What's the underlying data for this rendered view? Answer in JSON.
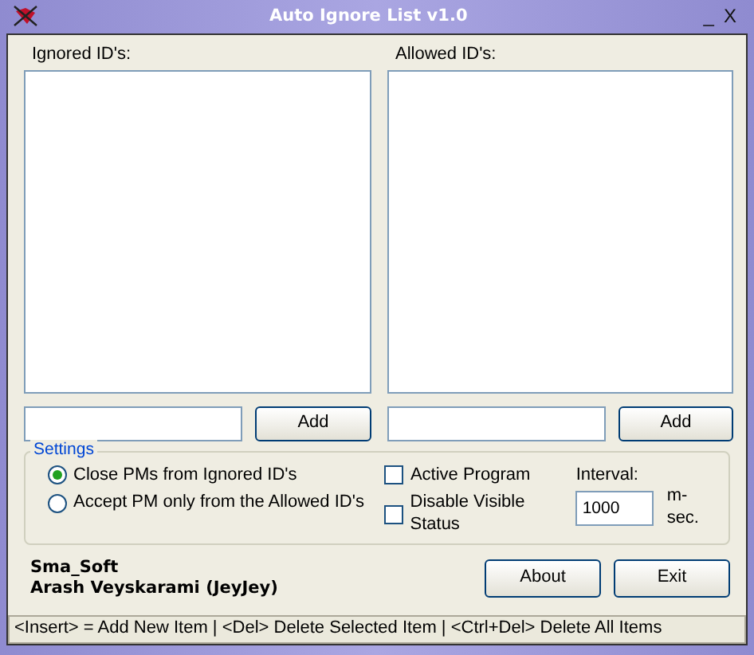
{
  "window": {
    "title": "Auto Ignore List v1.0",
    "controls": [
      "_",
      "X"
    ]
  },
  "lists": [
    {
      "label": "Ignored ID's:",
      "button": "Add"
    },
    {
      "label": "Allowed ID's:",
      "button": "Add"
    }
  ],
  "settings": {
    "title": "Settings",
    "radios": [
      {
        "label": "Close PMs from Ignored ID's",
        "selected": true
      },
      {
        "label": "Accept PM only from the Allowed ID's",
        "selected": false
      }
    ],
    "checkboxes": [
      {
        "label": "Active Program",
        "checked": false
      },
      {
        "label": "Disable Visible Status",
        "checked": false
      }
    ],
    "interval": {
      "label": "Interval:",
      "value": "1000",
      "unit": "m-sec."
    }
  },
  "credits": [
    "Sma_Soft",
    "Arash Veyskarami (JeyJey)"
  ],
  "buttons": [
    "About",
    "Exit"
  ],
  "status_bar": "<Insert> = Add New Item | <Del> Delete Selected Item | <Ctrl+Del> Delete All Items"
}
